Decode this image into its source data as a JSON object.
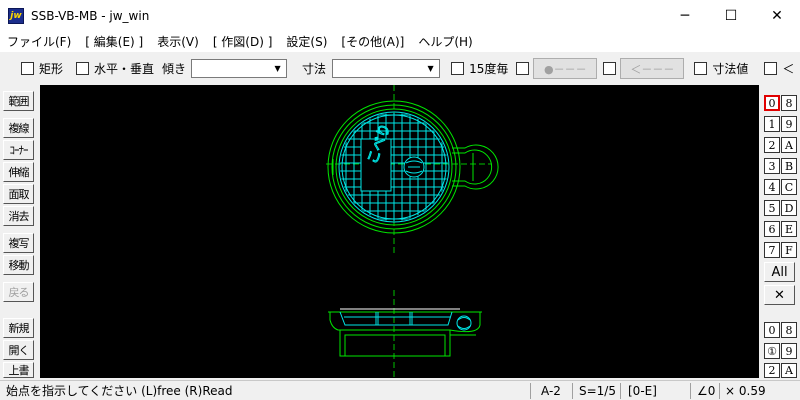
{
  "window": {
    "app_icon": "jw",
    "title": "SSB-VB-MB - jw_win",
    "minimize": "─",
    "maximize": "☐",
    "close": "✕"
  },
  "menu": [
    "ファイル(F)",
    "[ 編集(E) ]",
    "表示(V)",
    "[ 作図(D) ]",
    "設定(S)",
    "[その他(A)]",
    "ヘルプ(H)"
  ],
  "toolbar": {
    "rect_label": "矩形",
    "horiz_vert_label": "水平・垂直",
    "tilt_label": "傾き",
    "tilt_value": "",
    "dim_label": "寸法",
    "dim_value": "",
    "deg15_label": "15度毎",
    "btn_dot": "●－－－",
    "btn_arrow": "＜－－－",
    "dim_value_label": "寸法値",
    "last_label": "＜"
  },
  "left_tools": [
    "範囲",
    "複線",
    "ｺｰﾅｰ",
    "伸縮",
    "面取",
    "消去",
    "複写",
    "移動",
    "戻る",
    "新規",
    "開く",
    "上書"
  ],
  "layers_top": [
    "0",
    "8",
    "1",
    "9",
    "2",
    "A",
    "3",
    "B",
    "4",
    "C",
    "5",
    "D",
    "6",
    "E",
    "7",
    "F"
  ],
  "layers_all": "All",
  "layers_clear": "✕",
  "layers_bottom": [
    "0",
    "8",
    "①",
    "9",
    "2",
    "A"
  ],
  "status": {
    "message": "始点を指示してください (L)free (R)Read",
    "paper": "A-2",
    "scale": "S=1/5",
    "layer": "[0-E]",
    "angle": "∠0",
    "zoom": "× 0.59"
  },
  "colors": {
    "canvas": "#000000",
    "green": "#00e600",
    "cyan": "#00e6e6",
    "white": "#ffffff"
  }
}
